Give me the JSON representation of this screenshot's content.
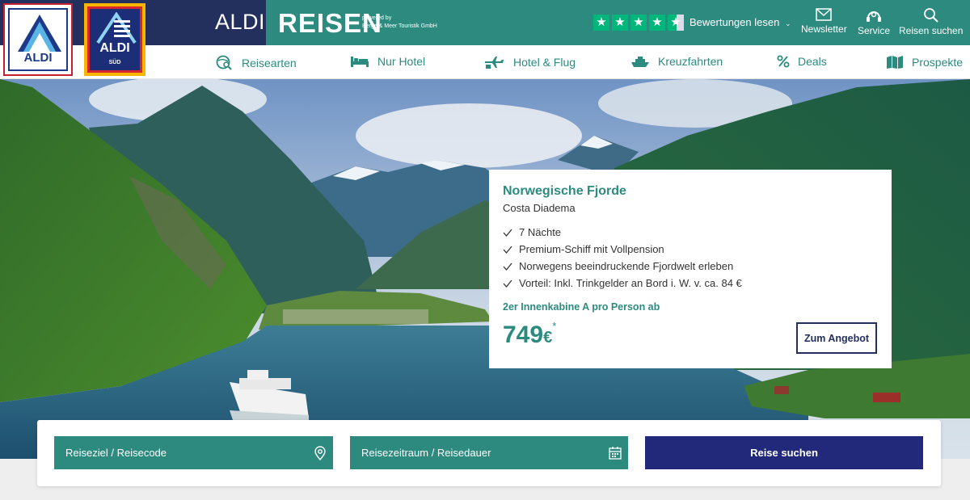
{
  "header": {
    "logo_left_text": "ALDI",
    "logo_right_text": "ALDI",
    "logo_right_sub": "SÜD",
    "brand_aldi": "ALDI",
    "brand_reisen": "REISEN",
    "powered_line1": "powered by",
    "powered_line2": "Berge & Meer Touristik GmbH",
    "rating_stars": 4.5,
    "reviews_label": "Bewertungen lesen",
    "icons": [
      {
        "name": "newsletter-icon",
        "label": "Newsletter"
      },
      {
        "name": "service-icon",
        "label": "Service"
      },
      {
        "name": "search-icon",
        "label": "Reisen suchen"
      }
    ]
  },
  "nav": {
    "items": [
      {
        "icon": "globe-search-icon",
        "label": "Reisearten"
      },
      {
        "icon": "bed-icon",
        "label": "Nur Hotel"
      },
      {
        "icon": "plane-hotel-icon",
        "label": "Hotel & Flug"
      },
      {
        "icon": "ship-icon",
        "label": "Kreuzfahrten"
      },
      {
        "icon": "percent-icon",
        "label": "Deals"
      },
      {
        "icon": "brochure-icon",
        "label": "Prospekte"
      }
    ]
  },
  "offer": {
    "title": "Norwegische Fjorde",
    "subtitle": "Costa Diadema",
    "features": [
      "7 Nächte",
      "Premium-Schiff mit Vollpension",
      "Norwegens beeindruckende Fjordwelt erleben",
      "Vorteil: Inkl. Trinkgelder an Bord i. W. v. ca. 84 €"
    ],
    "price_label": "2er Innenkabine A pro Person ab",
    "price": "749",
    "currency": "€",
    "price_mark": "*",
    "cta": "Zum Angebot"
  },
  "search": {
    "destination_placeholder": "Reiseziel / Reisecode",
    "dates_placeholder": "Reisezeitraum / Reisedauer",
    "submit": "Reise suchen"
  },
  "colors": {
    "teal": "#2c8a7f",
    "navy": "#23305e",
    "button_navy": "#23297a",
    "trustpilot_green": "#00b67a"
  }
}
